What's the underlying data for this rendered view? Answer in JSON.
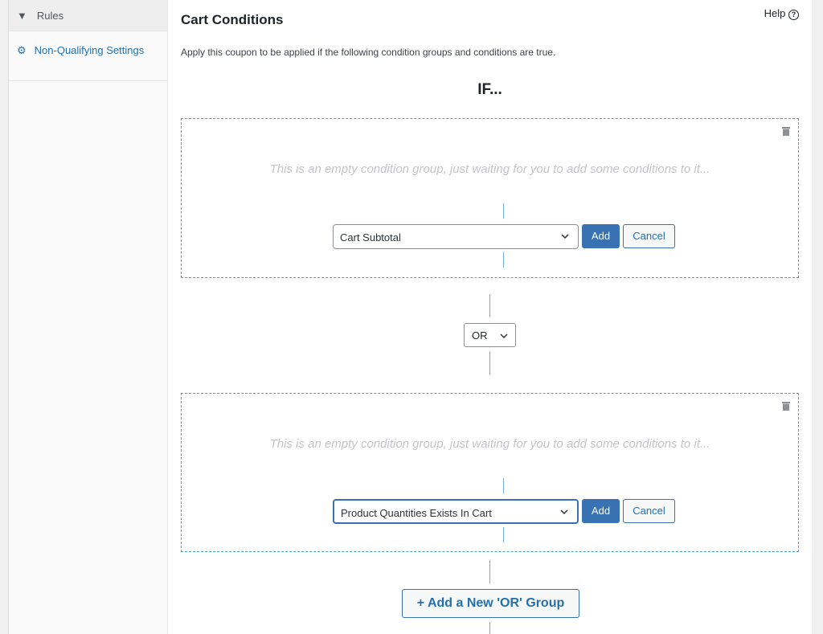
{
  "sidebar": {
    "items": [
      {
        "label": "Rules",
        "icon": "filter-icon"
      },
      {
        "label": "Non-Qualifying Settings",
        "icon": "gear-icon"
      }
    ]
  },
  "main": {
    "title": "Cart Conditions",
    "help": "Help",
    "description": "Apply this coupon to be applied if the following condition groups and conditions are true.",
    "if_label": "IF...",
    "groups": [
      {
        "empty_text": "This is an empty condition group, just waiting for you to add some conditions to it...",
        "selected": "Cart Subtotal",
        "add": "Add",
        "cancel": "Cancel"
      },
      {
        "empty_text": "This is an empty condition group, just waiting for you to add some conditions to it...",
        "selected": "Product Quantities Exists In Cart",
        "add": "Add",
        "cancel": "Cancel"
      }
    ],
    "logic": "OR",
    "add_group": "Add a New 'OR' Group"
  },
  "colors": {
    "accent": "#3872b2",
    "dashed_border": "#4a9ed1"
  }
}
